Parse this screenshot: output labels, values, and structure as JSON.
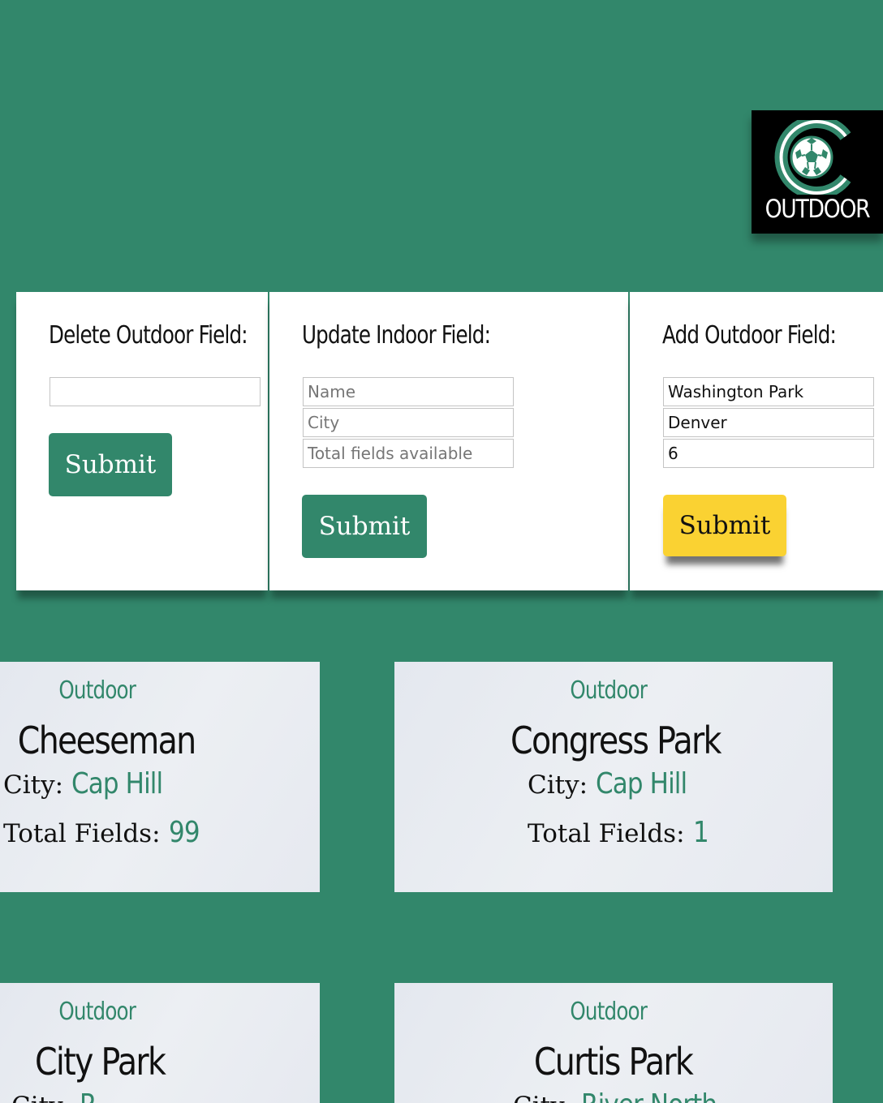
{
  "logo": {
    "text": "OUTDOOR",
    "icon": "soccer-ball-c-icon"
  },
  "forms": {
    "delete": {
      "title": "Delete Outdoor Field:",
      "input_value": "",
      "submit_label": "Submit"
    },
    "update": {
      "title": "Update Indoor Field:",
      "name_placeholder": "Name",
      "city_placeholder": "City",
      "total_placeholder": "Total fields available",
      "submit_label": "Submit"
    },
    "add": {
      "title": "Add Outdoor Field:",
      "name_value": "Washington Park",
      "city_value": "Denver",
      "total_value": "6",
      "submit_label": "Submit"
    }
  },
  "cards": [
    {
      "type": "Outdoor",
      "name": "Cheeseman",
      "city_label": "City:",
      "city": "Cap Hill",
      "total_label": "Total Fields:",
      "total": "99"
    },
    {
      "type": "Outdoor",
      "name": "Congress Park",
      "city_label": "City:",
      "city": "Cap Hill",
      "total_label": "Total Fields:",
      "total": "1"
    },
    {
      "type": "Outdoor",
      "name": "City Park",
      "city_label": "City:",
      "city": "P",
      "total_label": "",
      "total": ""
    },
    {
      "type": "Outdoor",
      "name": "Curtis Park",
      "city_label": "City:",
      "city": "River North",
      "total_label": "",
      "total": ""
    }
  ],
  "colors": {
    "background": "#32876b",
    "accent": "#32876b",
    "submit_highlight": "#fad232"
  }
}
